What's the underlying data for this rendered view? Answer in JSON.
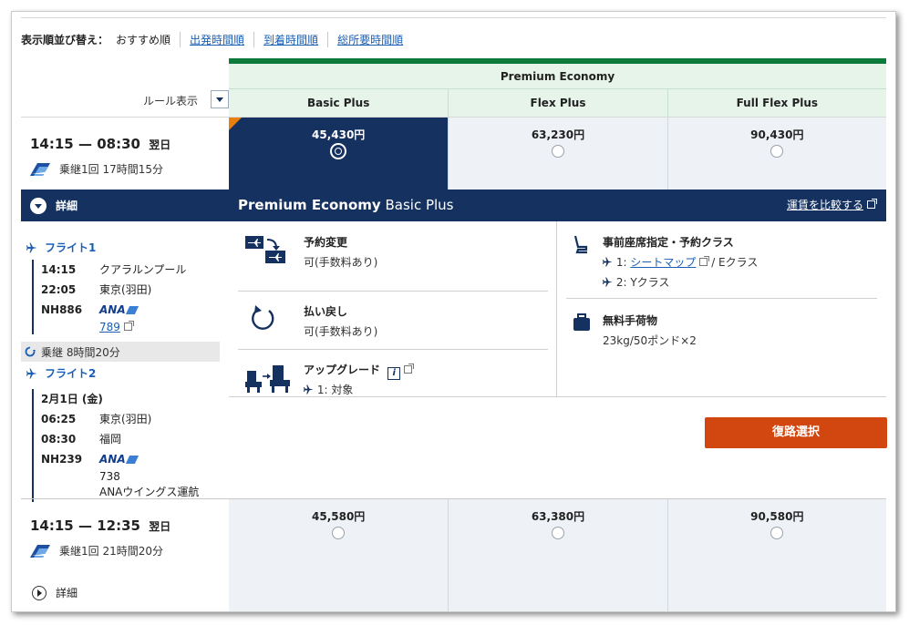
{
  "sort": {
    "label": "表示順並び替え：",
    "current": "おすすめ順",
    "options": [
      "出発時間順",
      "到着時間順",
      "総所要時間順"
    ]
  },
  "rules": {
    "label": "ルール表示"
  },
  "cabin": {
    "name": "Premium Economy"
  },
  "fares": [
    {
      "name": "Basic Plus"
    },
    {
      "name": "Flex Plus"
    },
    {
      "name": "Full Flex Plus"
    }
  ],
  "flights": [
    {
      "depart": "14:15",
      "dash": "—",
      "arrive": "08:30",
      "next_day": "翌日",
      "summary": "乗継1回 17時間15分",
      "prices": [
        "45,430円",
        "63,230円",
        "90,430円"
      ],
      "selected_index": 0
    },
    {
      "depart": "14:15",
      "dash": "—",
      "arrive": "12:35",
      "next_day": "翌日",
      "summary": "乗継1回 21時間20分",
      "prices": [
        "45,580円",
        "63,380円",
        "90,580円"
      ],
      "selected_index": -1,
      "details_label": "詳細"
    }
  ],
  "details": {
    "toggle_label": "詳細",
    "fare_title_bold": "Premium Economy",
    "fare_title_rest": "Basic Plus",
    "compare_link": "運賃を比較する"
  },
  "segments": [
    {
      "title": "フライト1",
      "lines": [
        {
          "time": "14:15",
          "place": "クアラルンプール"
        },
        {
          "time": "22:05",
          "place": "東京(羽田)"
        }
      ],
      "flight_no": "NH886",
      "airline_logo": "ANA",
      "aircraft": "789"
    },
    {
      "title": "フライト2",
      "date": "2月1日 (金)",
      "lines": [
        {
          "time": "06:25",
          "place": "東京(羽田)"
        },
        {
          "time": "08:30",
          "place": "福岡"
        }
      ],
      "flight_no": "NH239",
      "airline_logo": "ANA",
      "aircraft": "738",
      "operator": "ANAウイングス運航"
    }
  ],
  "layover": {
    "text": "乗継 8時間20分"
  },
  "conditions": {
    "change": {
      "title": "予約変更",
      "text": "可(手数料あり)",
      "icon": "change-booking-icon"
    },
    "refund": {
      "title": "払い戻し",
      "text": "可(手数料あり)",
      "icon": "refund-icon"
    },
    "upgrade": {
      "title": "アップグレード",
      "seg": "1:",
      "text": "対象",
      "icon": "upgrade-seat-icon"
    },
    "seat": {
      "title": "事前座席指定・予約クラス",
      "seg1_prefix": "1:",
      "seg1_link": "シートマップ",
      "seg1_class": "/ Eクラス",
      "seg2": "2: Yクラス",
      "icon": "seat-icon"
    },
    "baggage": {
      "title": "無料手荷物",
      "text": "23kg/50ポンド×2",
      "icon": "baggage-icon"
    }
  },
  "actions": {
    "select_return": "復路選択"
  },
  "colors": {
    "navy": "#15315f",
    "green": "#0b7a3b",
    "orange_button": "#d2460f",
    "link": "#1a5fb4"
  }
}
